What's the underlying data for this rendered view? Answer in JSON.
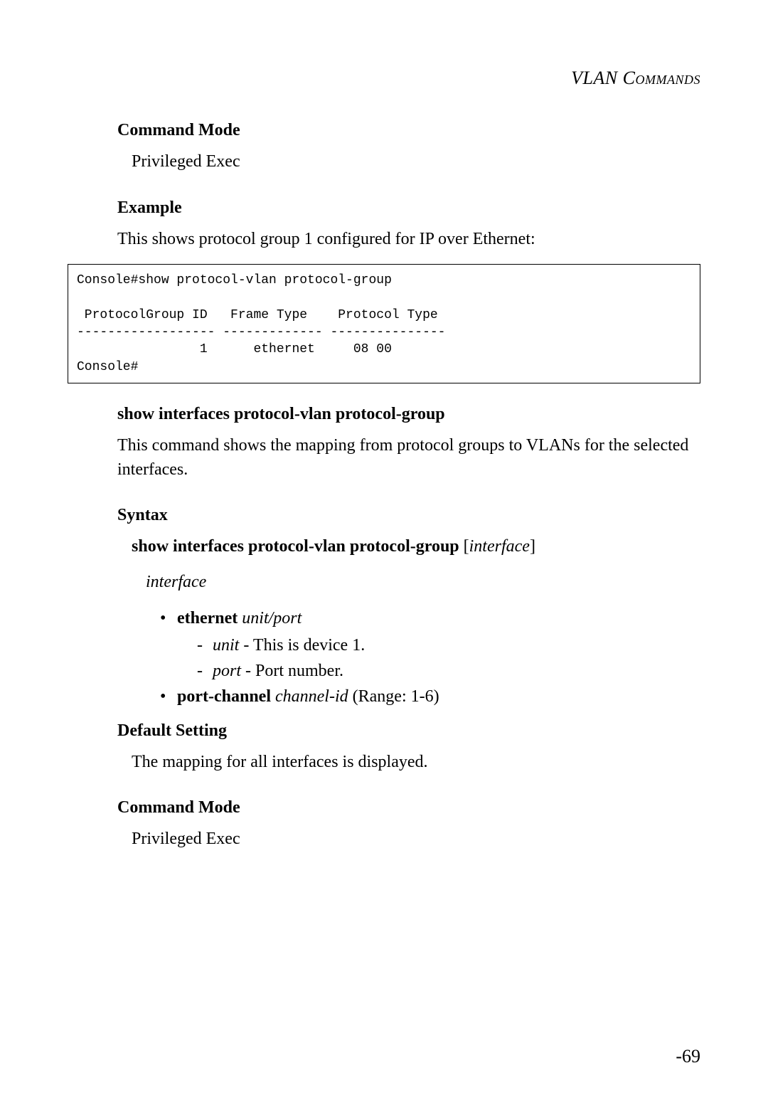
{
  "header": {
    "section_title": "VLAN Commands"
  },
  "sections": {
    "cmd_mode_1": {
      "heading": "Command Mode",
      "body": "Privileged Exec"
    },
    "example": {
      "heading": "Example",
      "intro": "This shows protocol group 1 configured for IP over Ethernet:"
    },
    "console": "Console#show protocol-vlan protocol-group\n\n ProtocolGroup ID   Frame Type    Protocol Type\n------------------ ------------- ---------------\n                1      ethernet     08 00\nConsole#",
    "cmd2": {
      "heading": "show interfaces protocol-vlan protocol-group",
      "desc": "This command shows the mapping from protocol groups to VLANs for the selected interfaces."
    },
    "syntax": {
      "heading": "Syntax",
      "line_cmd": "show interfaces protocol-vlan protocol-group",
      "line_bracket_open": " [",
      "line_param": "interface",
      "line_bracket_close": "]",
      "interface_label": "interface",
      "ethernet_bold": "ethernet",
      "ethernet_italic": " unit/port",
      "unit_label": "unit",
      "unit_desc": " - This is device 1.",
      "port_label": "port",
      "port_desc": " - Port number.",
      "portchannel_bold": "port-channel",
      "portchannel_italic": " channel-id",
      "portchannel_range": " (Range: 1-6)"
    },
    "default_setting": {
      "heading": "Default Setting",
      "body": "The mapping for all interfaces is displayed."
    },
    "cmd_mode_2": {
      "heading": "Command Mode",
      "body": "Privileged Exec"
    }
  },
  "page_number": "-69"
}
